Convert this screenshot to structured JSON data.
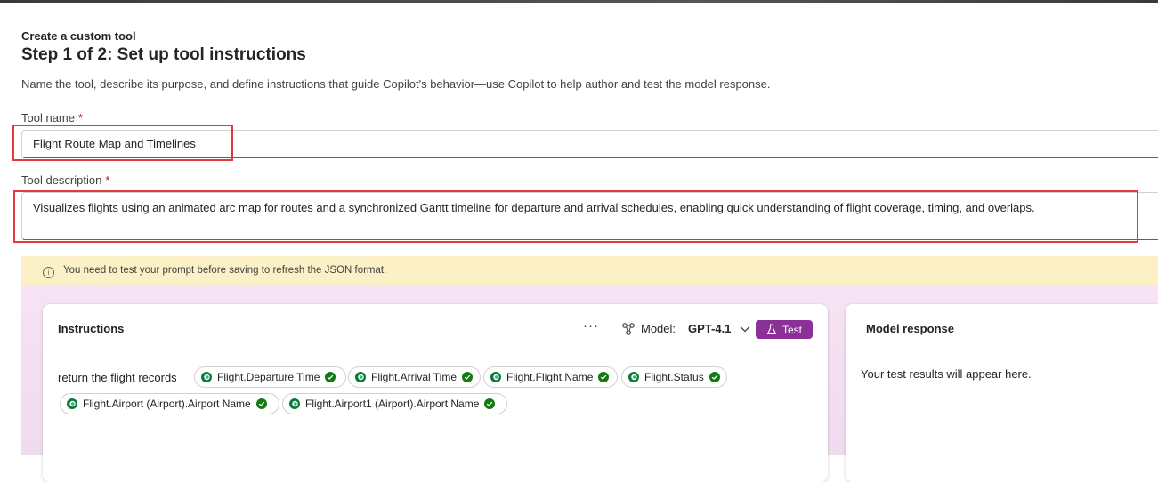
{
  "header": {
    "subtitle": "Create a custom tool",
    "title": "Step 1 of 2: Set up tool instructions",
    "description": "Name the tool, describe its purpose, and define instructions that guide Copilot's behavior—use Copilot to help author and test the model response."
  },
  "fields": {
    "tool_name": {
      "label": "Tool name",
      "required_mark": "*",
      "value": "Flight Route Map and Timelines"
    },
    "tool_description": {
      "label": "Tool description",
      "required_mark": "*",
      "value": "Visualizes flights using an animated arc map for routes and a synchronized Gantt timeline for departure and arrival schedules, enabling quick understanding of flight coverage, timing, and overlaps."
    }
  },
  "warning": {
    "text": "You need to test your prompt before saving to refresh the JSON format.",
    "icon": "info-icon"
  },
  "instructions": {
    "title": "Instructions",
    "more_label": "···",
    "model_label": "Model:",
    "model_value": "GPT-4.1",
    "test_label": "Test",
    "prompt_text": "return the flight records",
    "chips": [
      "Flight.Departure Time",
      "Flight.Arrival Time",
      "Flight.Flight Name",
      "Flight.Status",
      "Flight.Airport (Airport).Airport Name",
      "Flight.Airport1 (Airport).Airport Name"
    ]
  },
  "model_response": {
    "title": "Model response",
    "placeholder": "Your test results will appear here."
  },
  "colors": {
    "accent": "#8b3096",
    "highlight": "#e0393e",
    "warning_bg": "#fcf1c6",
    "check": "#107c10"
  }
}
